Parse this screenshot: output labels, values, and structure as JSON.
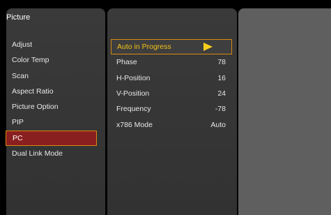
{
  "menu": {
    "title": "Picture",
    "items": [
      {
        "label": "Adjust"
      },
      {
        "label": "Color Temp"
      },
      {
        "label": "Scan"
      },
      {
        "label": "Aspect Ratio"
      },
      {
        "label": "Picture Option"
      },
      {
        "label": "PIP"
      },
      {
        "label": "PC",
        "selected": true
      },
      {
        "label": "Dual Link Mode"
      }
    ]
  },
  "submenu": {
    "items": [
      {
        "label": "Auto in Progress",
        "value": "",
        "active": true
      },
      {
        "label": "Phase",
        "value": "78"
      },
      {
        "label": "H-Position",
        "value": "16"
      },
      {
        "label": "V-Position",
        "value": "24"
      },
      {
        "label": "Frequency",
        "value": "-78"
      },
      {
        "label": "x786 Mode",
        "value": "Auto"
      }
    ]
  },
  "colors": {
    "selection_border": "#d88a10",
    "selection_fill": "#8a1f1f",
    "active_text": "#f3c21a"
  },
  "icons": {
    "active_indicator": "play-arrow-icon"
  }
}
